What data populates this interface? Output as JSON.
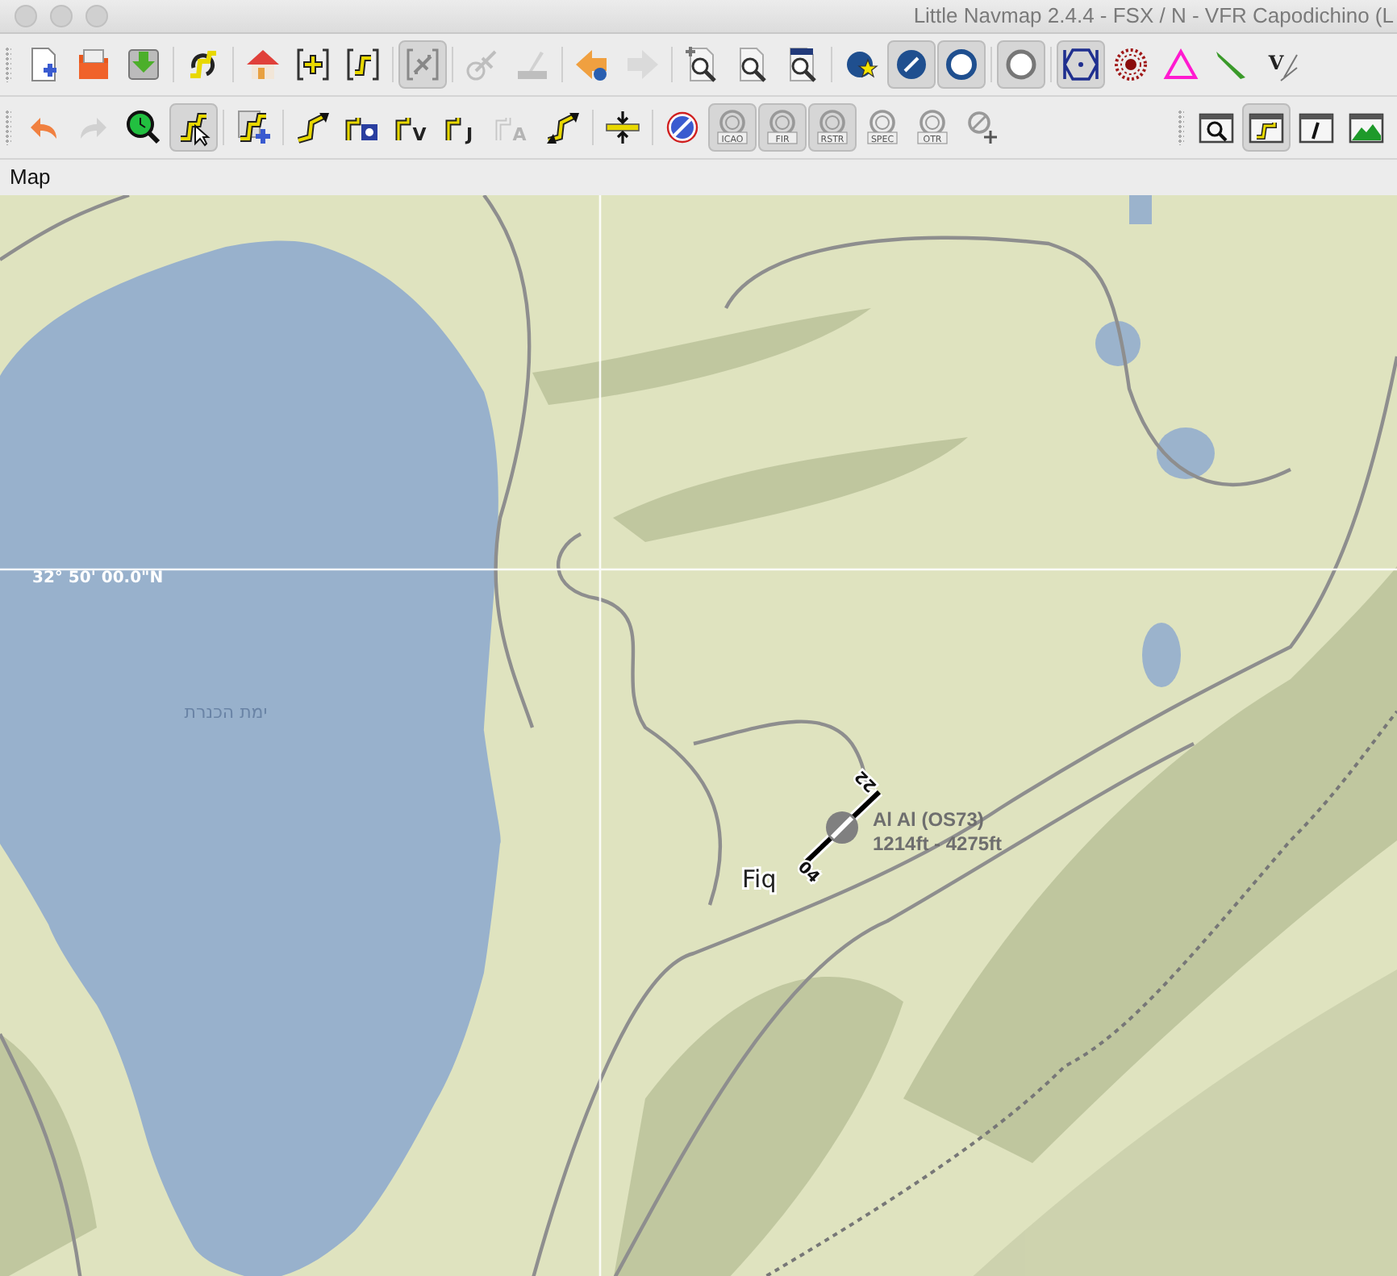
{
  "window": {
    "title": "Little Navmap 2.4.4 - FSX / N - VFR Capodichino (L"
  },
  "toolbars": [
    {
      "items": [
        {
          "kind": "new-file",
          "selected": false,
          "disabled": false
        },
        {
          "kind": "open-folder",
          "selected": false,
          "disabled": false
        },
        {
          "kind": "save",
          "selected": false,
          "disabled": false
        },
        {
          "kind": "separator"
        },
        {
          "kind": "reload",
          "selected": false,
          "disabled": false
        },
        {
          "kind": "separator"
        },
        {
          "kind": "home",
          "selected": false,
          "disabled": false
        },
        {
          "kind": "mark-add",
          "selected": false,
          "disabled": false
        },
        {
          "kind": "route-bracket",
          "selected": false,
          "disabled": false
        },
        {
          "kind": "separator"
        },
        {
          "kind": "aircraft",
          "selected": true,
          "disabled": false
        },
        {
          "kind": "separator"
        },
        {
          "kind": "aircraft-target",
          "selected": false,
          "disabled": true
        },
        {
          "kind": "brush",
          "selected": false,
          "disabled": true
        },
        {
          "kind": "separator"
        },
        {
          "kind": "back",
          "selected": false,
          "disabled": false
        },
        {
          "kind": "forward",
          "selected": false,
          "disabled": true
        },
        {
          "kind": "separator"
        },
        {
          "kind": "zoom-in",
          "selected": false,
          "disabled": false
        },
        {
          "kind": "zoom-page",
          "selected": false,
          "disabled": false
        },
        {
          "kind": "zoom-box",
          "selected": false,
          "disabled": false
        },
        {
          "kind": "separator"
        },
        {
          "kind": "star-marker",
          "selected": false,
          "disabled": false
        },
        {
          "kind": "circle-slash",
          "selected": true,
          "disabled": false
        },
        {
          "kind": "circle-ring",
          "selected": true,
          "disabled": false
        },
        {
          "kind": "separator"
        },
        {
          "kind": "circle-plain",
          "selected": true,
          "disabled": false
        },
        {
          "kind": "separator"
        },
        {
          "kind": "hexagon",
          "selected": true,
          "disabled": false
        },
        {
          "kind": "dotted-circle",
          "selected": false,
          "disabled": false
        },
        {
          "kind": "triangle",
          "selected": false,
          "disabled": false
        },
        {
          "kind": "needle",
          "selected": false,
          "disabled": false
        },
        {
          "kind": "letter-cross",
          "label": "V",
          "selected": false,
          "disabled": false
        }
      ]
    },
    {
      "items": [
        {
          "kind": "undo",
          "selected": false,
          "disabled": false
        },
        {
          "kind": "redo",
          "selected": false,
          "disabled": true
        },
        {
          "kind": "clock-magnifier",
          "selected": false,
          "disabled": false
        },
        {
          "kind": "route-cursor",
          "selected": true,
          "disabled": false
        },
        {
          "kind": "separator"
        },
        {
          "kind": "route-add",
          "selected": false,
          "disabled": false
        },
        {
          "kind": "separator"
        },
        {
          "kind": "route-arrow",
          "selected": false,
          "disabled": false
        },
        {
          "kind": "route-ndb",
          "selected": false,
          "disabled": false
        },
        {
          "kind": "route-letter",
          "label": "V",
          "selected": false,
          "disabled": false
        },
        {
          "kind": "route-letter",
          "label": "J",
          "selected": false,
          "disabled": false
        },
        {
          "kind": "route-letter",
          "label": "A",
          "selected": false,
          "disabled": true
        },
        {
          "kind": "route-double",
          "selected": false,
          "disabled": false
        },
        {
          "kind": "separator"
        },
        {
          "kind": "altitude",
          "selected": false,
          "disabled": false
        },
        {
          "kind": "separator"
        },
        {
          "kind": "airspace",
          "selected": false,
          "disabled": false
        },
        {
          "kind": "airspace-tag",
          "label": "ICAO",
          "selected": true,
          "disabled": false
        },
        {
          "kind": "airspace-tag",
          "label": "FIR",
          "selected": true,
          "disabled": false
        },
        {
          "kind": "airspace-tag",
          "label": "RSTR",
          "selected": true,
          "disabled": false
        },
        {
          "kind": "airspace-tag",
          "label": "SPEC",
          "selected": false,
          "disabled": false
        },
        {
          "kind": "airspace-tag",
          "label": "OTR",
          "selected": false,
          "disabled": false
        },
        {
          "kind": "airspace-pin",
          "selected": false,
          "disabled": false
        },
        {
          "kind": "spacer"
        },
        {
          "kind": "window-search",
          "selected": false,
          "disabled": false
        },
        {
          "kind": "window-route",
          "selected": true,
          "disabled": false
        },
        {
          "kind": "window-info",
          "selected": false,
          "disabled": false
        },
        {
          "kind": "window-profile",
          "selected": false,
          "disabled": false
        }
      ]
    }
  ],
  "dock": {
    "title": "Map"
  },
  "map": {
    "grid_label": "32° 50' 00.0\"N",
    "lake_label": "ימת הכנרת",
    "town_label": "Fiq",
    "airport": {
      "name": "Al Al (OS73)",
      "info": "1214ft - 4275ft",
      "runway_ends": [
        "22",
        "04"
      ]
    }
  }
}
